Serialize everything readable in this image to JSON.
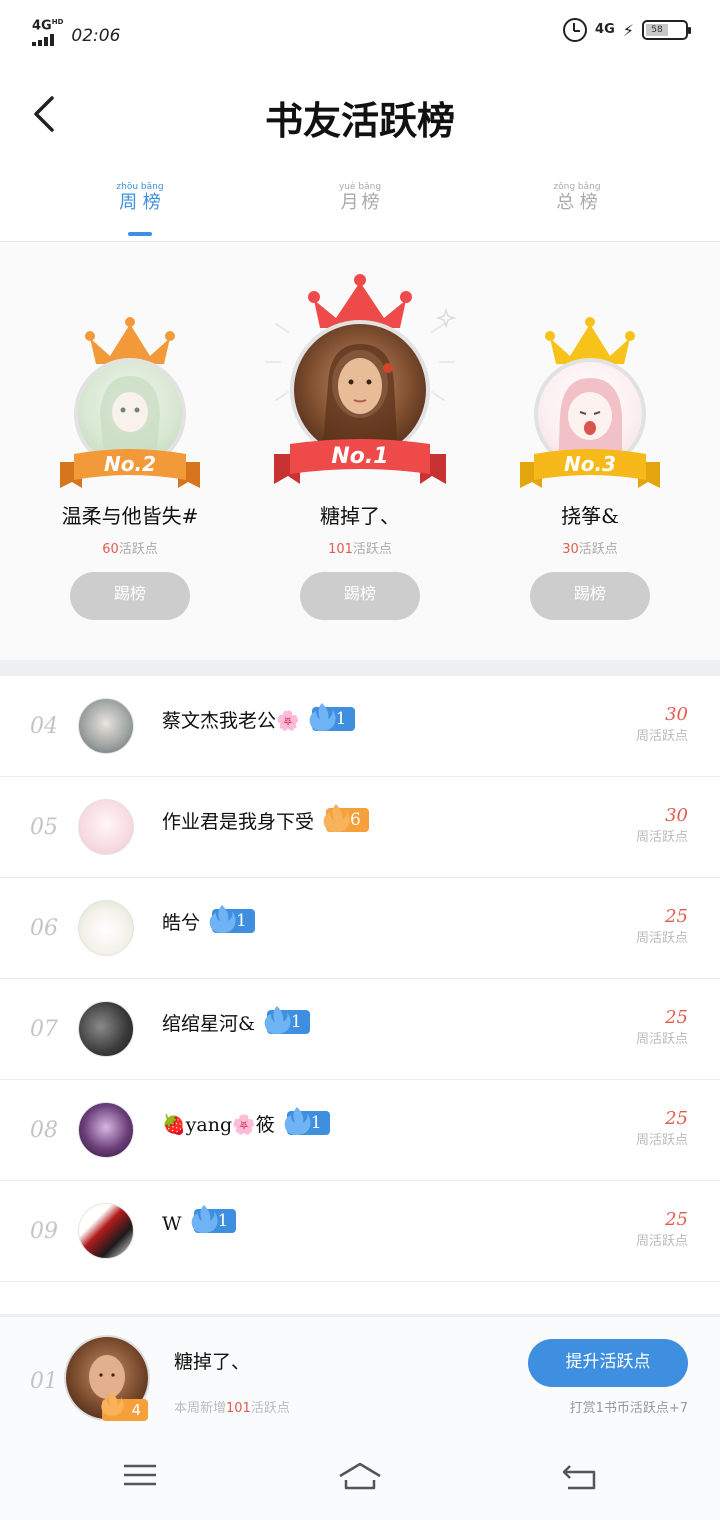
{
  "status_bar": {
    "network": "4G",
    "network_hd": "HD",
    "time": "02:06",
    "cell_type": "4G",
    "battery": "58"
  },
  "header": {
    "title": "书友活跃榜"
  },
  "tabs": [
    {
      "label": "周榜",
      "pinyin": "zhōu bǎng",
      "active": true
    },
    {
      "label": "月榜",
      "pinyin": "yuè bǎng",
      "active": false
    },
    {
      "label": "总榜",
      "pinyin": "zǒng bǎng",
      "active": false
    }
  ],
  "podium": [
    {
      "place": "No.2",
      "name": "温柔与他皆失#",
      "points": "60",
      "points_label": "活跃点",
      "button": "踢榜",
      "crown_color": "#f29a3a"
    },
    {
      "place": "No.1",
      "name": "糖掉了、",
      "points": "101",
      "points_label": "活跃点",
      "button": "踢榜",
      "crown_color": "#ef4a4a"
    },
    {
      "place": "No.3",
      "name": "挠筝&",
      "points": "30",
      "points_label": "活跃点",
      "button": "踢榜",
      "crown_color": "#f7c21a"
    }
  ],
  "list": [
    {
      "rank": "04",
      "name": "蔡文杰我老公🌸",
      "badge": "1",
      "badge_color": "blue",
      "score": "30",
      "score_label": "周活跃点"
    },
    {
      "rank": "05",
      "name": "作业君是我身下受",
      "badge": "6",
      "badge_color": "orange",
      "score": "30",
      "score_label": "周活跃点"
    },
    {
      "rank": "06",
      "name": "皓兮",
      "badge": "1",
      "badge_color": "blue",
      "score": "25",
      "score_label": "周活跃点"
    },
    {
      "rank": "07",
      "name": "绾绾星河&",
      "badge": "1",
      "badge_color": "blue",
      "score": "25",
      "score_label": "周活跃点"
    },
    {
      "rank": "08",
      "name": "🍓yang🌸筱",
      "badge": "1",
      "badge_color": "blue",
      "score": "25",
      "score_label": "周活跃点"
    },
    {
      "rank": "09",
      "name": "W",
      "badge": "1",
      "badge_color": "blue",
      "score": "25",
      "score_label": "周活跃点"
    }
  ],
  "me": {
    "rank": "01",
    "name": "糖掉了、",
    "badge": "4",
    "sub_prefix": "本周新增",
    "sub_points": "101",
    "sub_suffix": "活跃点",
    "button": "提升活跃点",
    "hint": "打赏1书币活跃点+7"
  },
  "colors": {
    "accent": "#3e8fe0",
    "score_red": "#e25b4f",
    "badge_orange": "#f5a03a"
  },
  "icons": {
    "back": "chevron-left-icon",
    "menu": "menu-icon",
    "home": "home-icon",
    "back_nav": "return-icon"
  }
}
